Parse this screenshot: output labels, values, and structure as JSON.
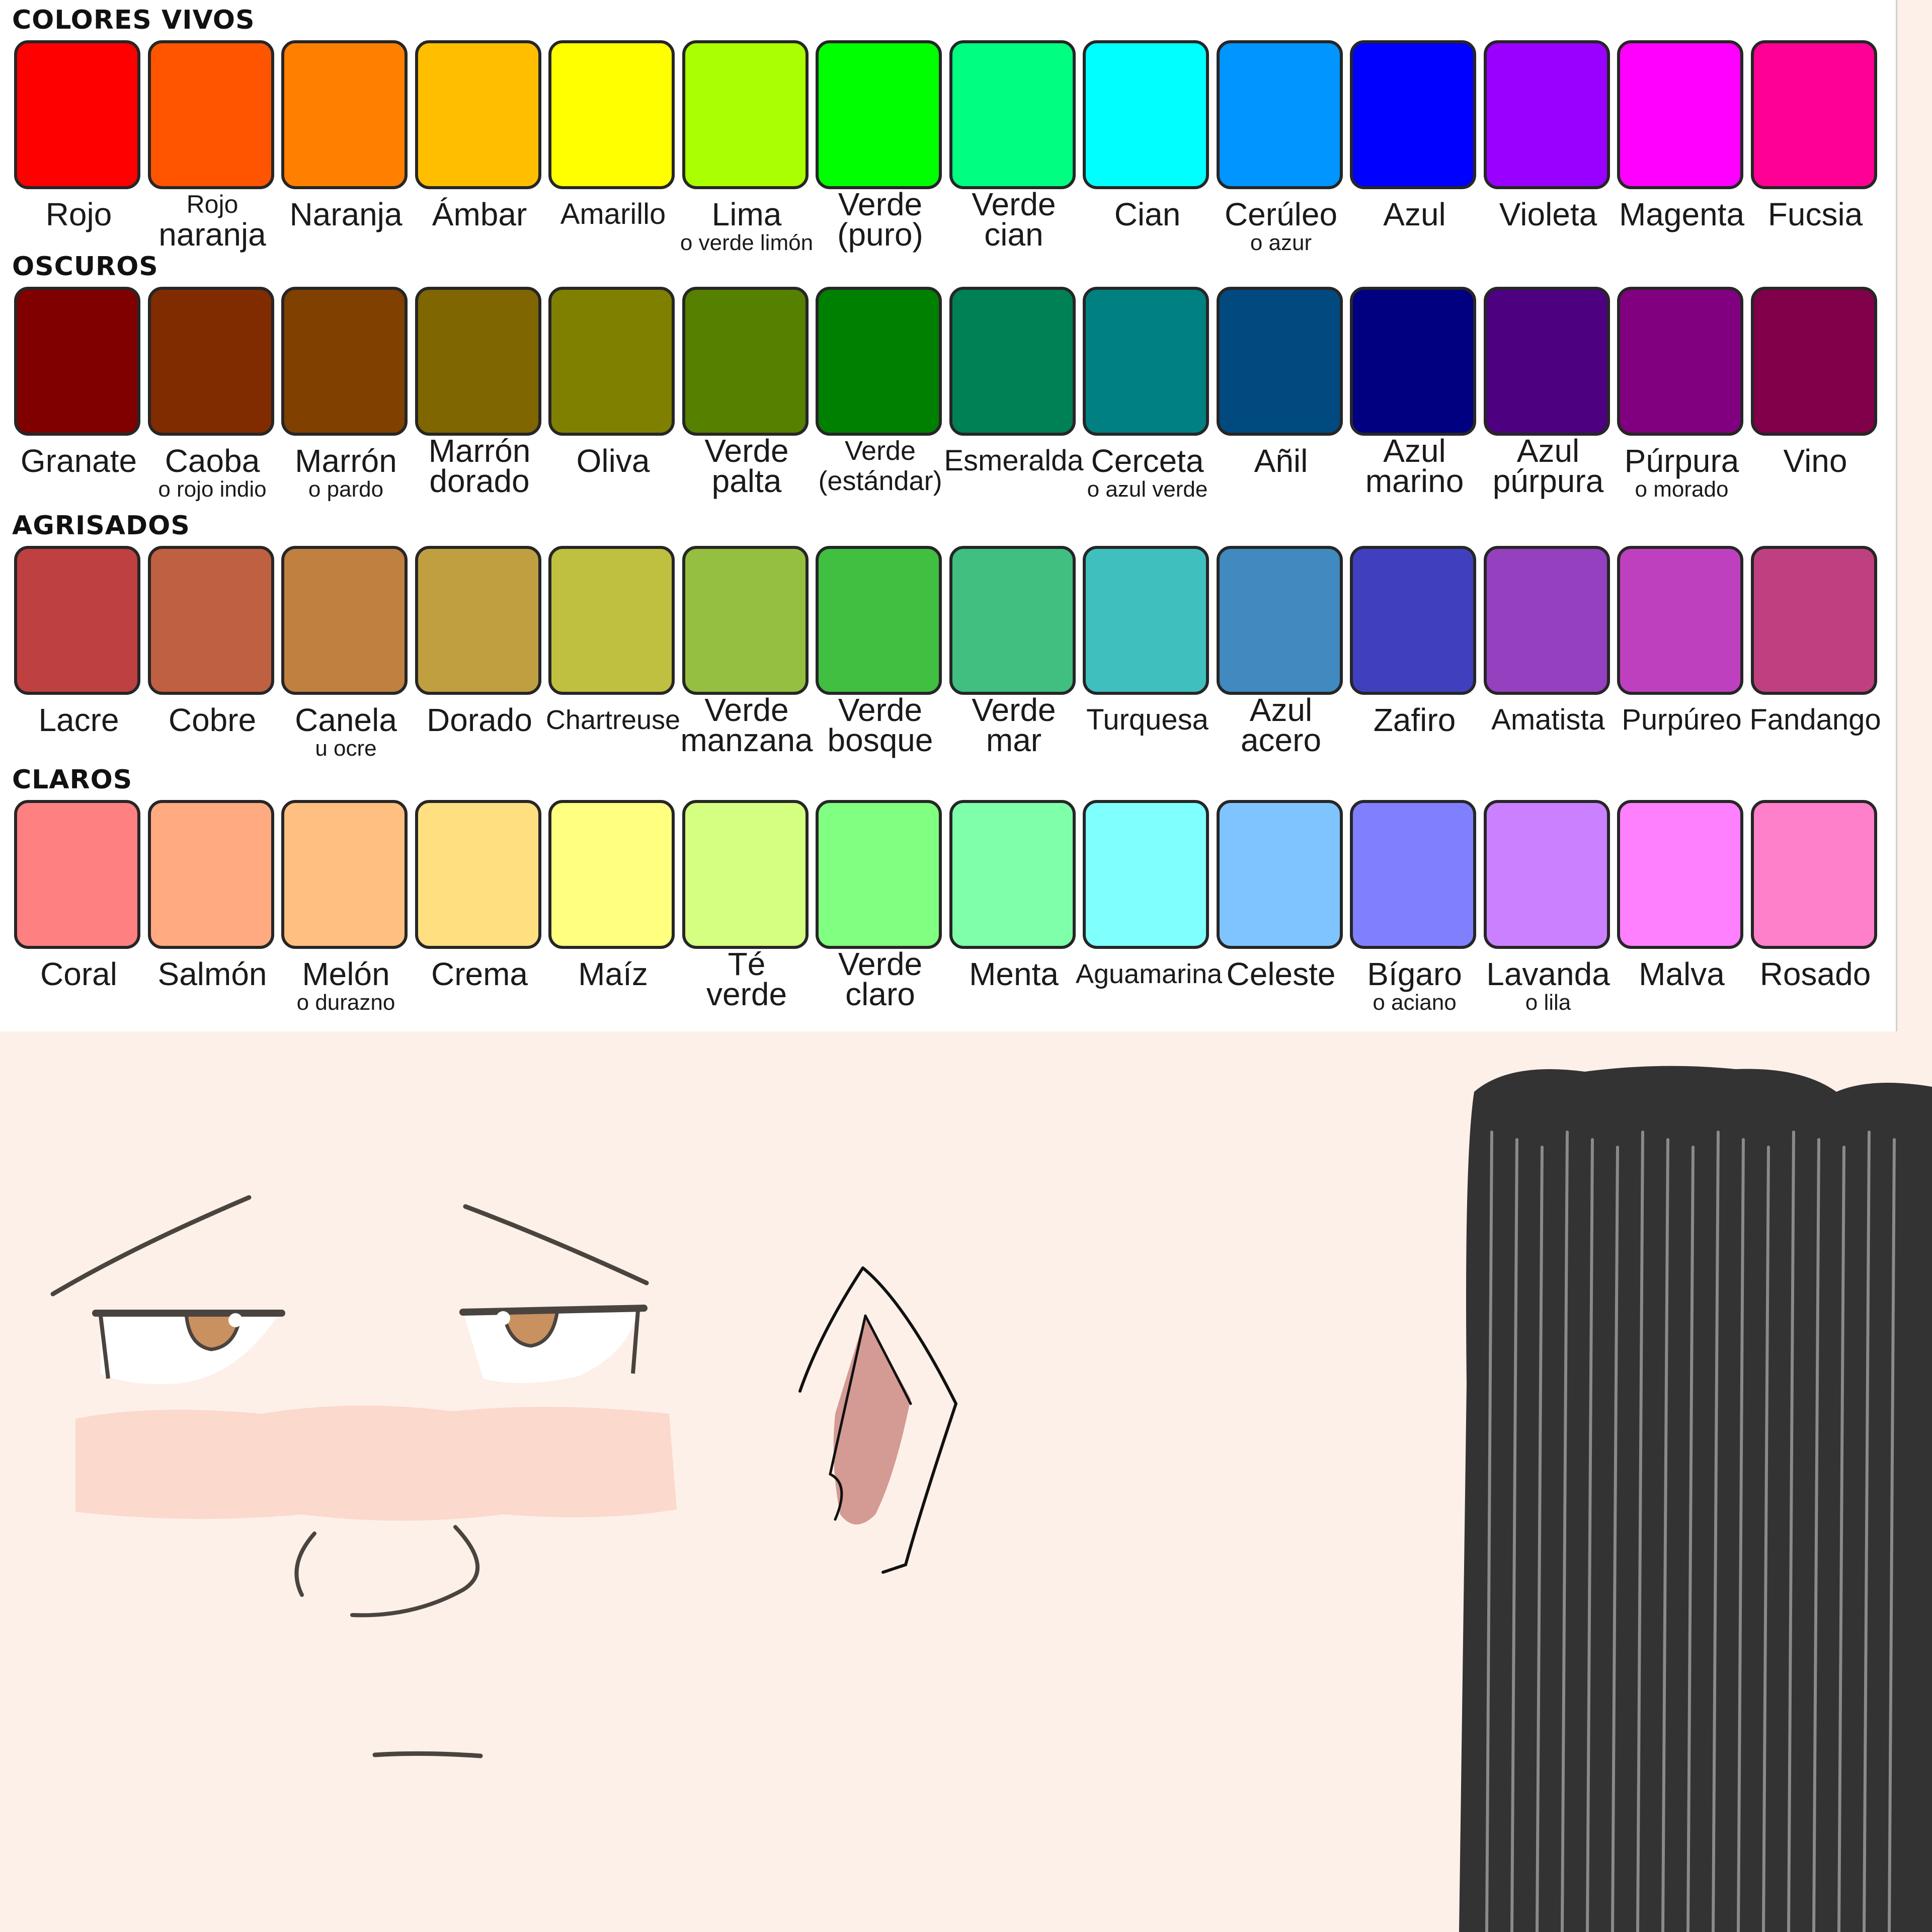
{
  "sections": [
    {
      "title": "COLORES VIVOS",
      "colors": [
        {
          "name": [
            "Rojo"
          ],
          "sub": "",
          "hex": "#ff0000"
        },
        {
          "name": [
            "Rojo",
            "naranja"
          ],
          "sub": "",
          "hex": "#ff5500"
        },
        {
          "name": [
            "Naranja"
          ],
          "sub": "",
          "hex": "#ff8000"
        },
        {
          "name": [
            "Ámbar"
          ],
          "sub": "",
          "hex": "#ffbf00"
        },
        {
          "name": [
            "Amarillo"
          ],
          "sub": "",
          "hex": "#ffff00"
        },
        {
          "name": [
            "Lima"
          ],
          "sub": "o verde limón",
          "hex": "#aaff00"
        },
        {
          "name": [
            "Verde",
            "(puro)"
          ],
          "sub": "",
          "hex": "#00ff00"
        },
        {
          "name": [
            "Verde",
            "cian"
          ],
          "sub": "",
          "hex": "#00ff80"
        },
        {
          "name": [
            "Cian"
          ],
          "sub": "",
          "hex": "#00ffff"
        },
        {
          "name": [
            "Cerúleo"
          ],
          "sub": "o azur",
          "hex": "#0095ff"
        },
        {
          "name": [
            "Azul"
          ],
          "sub": "",
          "hex": "#0000ff"
        },
        {
          "name": [
            "Violeta"
          ],
          "sub": "",
          "hex": "#9900ff"
        },
        {
          "name": [
            "Magenta"
          ],
          "sub": "",
          "hex": "#ff00ff"
        },
        {
          "name": [
            "Fucsia"
          ],
          "sub": "",
          "hex": "#ff0095"
        }
      ]
    },
    {
      "title": "OSCUROS",
      "colors": [
        {
          "name": [
            "Granate"
          ],
          "sub": "",
          "hex": "#800000"
        },
        {
          "name": [
            "Caoba"
          ],
          "sub": "o rojo indio",
          "hex": "#802b00"
        },
        {
          "name": [
            "Marrón"
          ],
          "sub": "o pardo",
          "hex": "#804000"
        },
        {
          "name": [
            "Marrón",
            "dorado"
          ],
          "sub": "",
          "hex": "#806600"
        },
        {
          "name": [
            "Oliva"
          ],
          "sub": "",
          "hex": "#808000"
        },
        {
          "name": [
            "Verde",
            "palta"
          ],
          "sub": "",
          "hex": "#558000"
        },
        {
          "name": [
            "Verde",
            "(estándar)"
          ],
          "sub": "",
          "hex": "#008000"
        },
        {
          "name": [
            "Esmeralda"
          ],
          "sub": "",
          "hex": "#008055"
        },
        {
          "name": [
            "Cerceta"
          ],
          "sub": "o azul verde",
          "hex": "#008080"
        },
        {
          "name": [
            "Añil"
          ],
          "sub": "",
          "hex": "#004a80"
        },
        {
          "name": [
            "Azul",
            "marino"
          ],
          "sub": "",
          "hex": "#000080"
        },
        {
          "name": [
            "Azul",
            "púrpura"
          ],
          "sub": "",
          "hex": "#4d0080"
        },
        {
          "name": [
            "Púrpura"
          ],
          "sub": "o morado",
          "hex": "#800080"
        },
        {
          "name": [
            "Vino"
          ],
          "sub": "",
          "hex": "#80004a"
        }
      ]
    },
    {
      "title": "AGRISADOS",
      "colors": [
        {
          "name": [
            "Lacre"
          ],
          "sub": "",
          "hex": "#bf4040"
        },
        {
          "name": [
            "Cobre"
          ],
          "sub": "",
          "hex": "#bf6040"
        },
        {
          "name": [
            "Canela"
          ],
          "sub": "u ocre",
          "hex": "#bf8040"
        },
        {
          "name": [
            "Dorado"
          ],
          "sub": "",
          "hex": "#bf9f40"
        },
        {
          "name": [
            "Chartreuse"
          ],
          "sub": "",
          "hex": "#bfbf40"
        },
        {
          "name": [
            "Verde",
            "manzana"
          ],
          "sub": "",
          "hex": "#95bf40"
        },
        {
          "name": [
            "Verde",
            "bosque"
          ],
          "sub": "",
          "hex": "#40bf40"
        },
        {
          "name": [
            "Verde",
            "mar"
          ],
          "sub": "",
          "hex": "#40bf80"
        },
        {
          "name": [
            "Turquesa"
          ],
          "sub": "",
          "hex": "#40bfbf"
        },
        {
          "name": [
            "Azul",
            "acero"
          ],
          "sub": "",
          "hex": "#408abf"
        },
        {
          "name": [
            "Zafiro"
          ],
          "sub": "",
          "hex": "#4040bf"
        },
        {
          "name": [
            "Amatista"
          ],
          "sub": "",
          "hex": "#9540bf"
        },
        {
          "name": [
            "Purpúreo"
          ],
          "sub": "",
          "hex": "#bf40bf"
        },
        {
          "name": [
            "Fandango"
          ],
          "sub": "",
          "hex": "#bf4080"
        }
      ]
    },
    {
      "title": "CLAROS",
      "colors": [
        {
          "name": [
            "Coral"
          ],
          "sub": "",
          "hex": "#ff8080"
        },
        {
          "name": [
            "Salmón"
          ],
          "sub": "",
          "hex": "#ffaa80"
        },
        {
          "name": [
            "Melón"
          ],
          "sub": "o durazno",
          "hex": "#ffbf80"
        },
        {
          "name": [
            "Crema"
          ],
          "sub": "",
          "hex": "#ffdf80"
        },
        {
          "name": [
            "Maíz"
          ],
          "sub": "",
          "hex": "#ffff80"
        },
        {
          "name": [
            "Té",
            "verde"
          ],
          "sub": "",
          "hex": "#d4ff80"
        },
        {
          "name": [
            "Verde",
            "claro"
          ],
          "sub": "",
          "hex": "#80ff80"
        },
        {
          "name": [
            "Menta"
          ],
          "sub": "",
          "hex": "#80ffaa"
        },
        {
          "name": [
            "Aguamarina"
          ],
          "sub": "",
          "hex": "#80ffff"
        },
        {
          "name": [
            "Celeste"
          ],
          "sub": "",
          "hex": "#80c4ff"
        },
        {
          "name": [
            "Bígaro"
          ],
          "sub": "o aciano",
          "hex": "#8080ff"
        },
        {
          "name": [
            "Lavanda"
          ],
          "sub": "o lila",
          "hex": "#ca80ff"
        },
        {
          "name": [
            "Malva"
          ],
          "sub": "",
          "hex": "#ff80ff"
        },
        {
          "name": [
            "Rosado"
          ],
          "sub": "",
          "hex": "#ff80ca"
        }
      ]
    }
  ],
  "drawing": {
    "skin": "#fdf0e8",
    "blush": "#fbd9cc",
    "line": "#4a4440",
    "iris": "#c9915f",
    "ear_inner": "#d49a94",
    "hair": "#333333",
    "hair_highlight": "#8a8a8a"
  }
}
